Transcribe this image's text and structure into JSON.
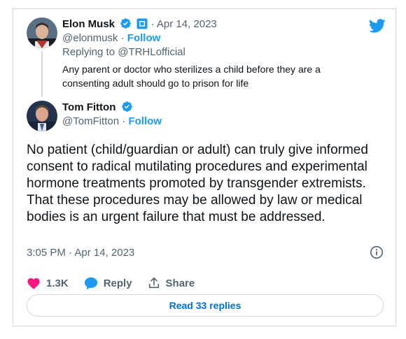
{
  "quoted_tweet": {
    "author_name": "Elon Musk",
    "date": "Apr 14, 2023",
    "date_separator": "·",
    "handle": "@elonmusk",
    "follow_label": "Follow",
    "handle_separator": "·",
    "replying_to": "Replying to @TRHLofficial",
    "text": "Any parent or doctor who sterilizes a child before they are a consenting adult should go to prison for life",
    "verified_icon": "verified-badge-icon",
    "affiliate_icon": "affiliate-badge-icon"
  },
  "main_tweet": {
    "author_name": "Tom Fitton",
    "handle": "@TomFitton",
    "handle_separator": "·",
    "follow_label": "Follow",
    "text": "No patient (child/guardian or adult) can truly give informed consent to radical mutilating procedures and experimental hormone treatments promoted by transgender extremists. That these procedures may be allowed by law or medical bodies is an urgent failure that must be addressed.",
    "timestamp": "3:05 PM · Apr 14, 2023",
    "verified_icon": "verified-badge-icon"
  },
  "actions": {
    "like_count": "1.3K",
    "reply_label": "Reply",
    "share_label": "Share"
  },
  "read_replies_label": "Read 33 replies",
  "colors": {
    "accent": "#1d9bf0",
    "like": "#f91880",
    "muted": "#536471",
    "border": "#cfd9de"
  }
}
